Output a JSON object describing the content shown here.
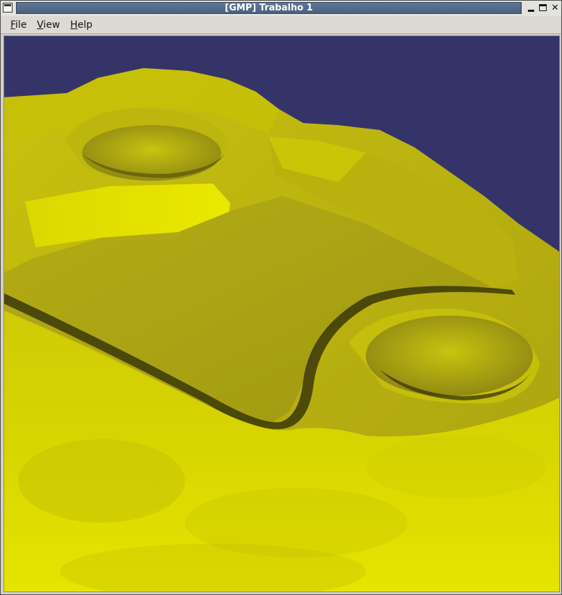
{
  "window": {
    "title": "[GMP] Trabalho 1",
    "controls": {
      "minimize": "minimize-icon",
      "maximize": "maximize-icon",
      "close": "close-icon"
    }
  },
  "menubar": {
    "items": [
      {
        "mnemonic": "F",
        "rest": "ile"
      },
      {
        "mnemonic": "V",
        "rest": "iew"
      },
      {
        "mnemonic": "H",
        "rest": "elp"
      }
    ]
  },
  "viewport": {
    "background_color": "#353468",
    "surface_color": "#d6d400"
  }
}
